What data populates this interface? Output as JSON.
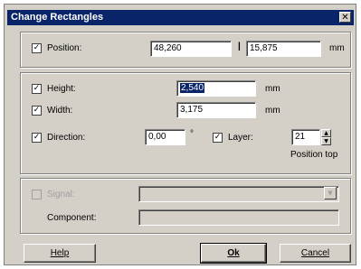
{
  "dialog": {
    "title": "Change Rectangles",
    "close_glyph": "✕"
  },
  "position": {
    "checked": true,
    "label": "Position:",
    "x": "48,260",
    "separator": "|",
    "y": "15,875",
    "unit": "mm"
  },
  "height": {
    "checked": true,
    "label": "Height:",
    "value": "2,540",
    "unit": "mm"
  },
  "width": {
    "checked": true,
    "label": "Width:",
    "value": "3,175",
    "unit": "mm"
  },
  "direction": {
    "checked": true,
    "label": "Direction:",
    "value": "0,00",
    "unit": "°"
  },
  "layer": {
    "checked": true,
    "label": "Layer:",
    "value": "21",
    "caption": "Position top"
  },
  "signal": {
    "checked": false,
    "label": "Signal:",
    "value": ""
  },
  "component": {
    "label": "Component:",
    "value": ""
  },
  "buttons": {
    "help": "Help",
    "ok": "Ok",
    "cancel": "Cancel"
  },
  "icons": {
    "check": "✓",
    "spin_up": "▲",
    "spin_down": "▼",
    "dropdown": "▼"
  }
}
